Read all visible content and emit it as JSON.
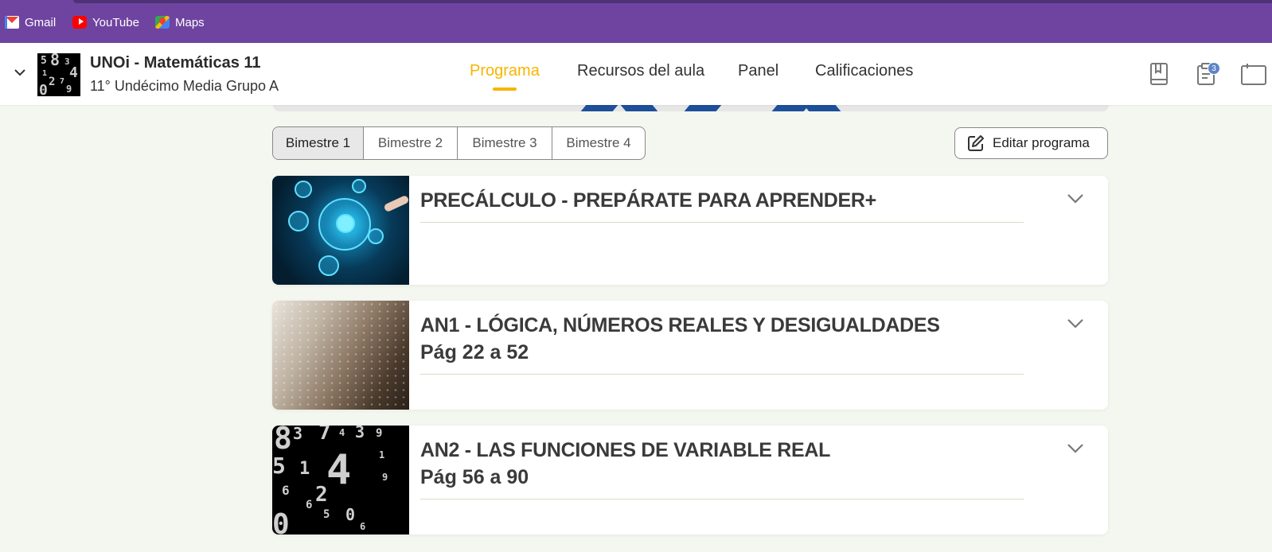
{
  "bookmarks": [
    {
      "label": "Gmail",
      "icon": "gmail-icon"
    },
    {
      "label": "YouTube",
      "icon": "youtube-icon"
    },
    {
      "label": "Maps",
      "icon": "maps-icon"
    }
  ],
  "course": {
    "title": "UNOi - Matemáticas 11",
    "group": "11° Undécimo Media Grupo A"
  },
  "nav": {
    "tabs": [
      "Programa",
      "Recursos del aula",
      "Panel",
      "Calificaciones"
    ],
    "active_tab": "Programa"
  },
  "header_icons": {
    "book": "book-icon",
    "clipboard": "clipboard-icon",
    "clipboard_badge": "3",
    "calendar": "calendar-icon"
  },
  "bimestres": {
    "tabs": [
      "Bimestre 1",
      "Bimestre 2",
      "Bimestre 3",
      "Bimestre 4"
    ],
    "selected": "Bimestre 1"
  },
  "edit_button_label": "Editar programa",
  "units": [
    {
      "title": "PRECÁLCULO - PREPÁRATE PARA APRENDER+",
      "pages": ""
    },
    {
      "title": "AN1 - LÓGICA, NÚMEROS REALES Y DESIGUALDADES",
      "pages": "Pág 22 a 52"
    },
    {
      "title": "AN2 - LAS FUNCIONES DE VARIABLE REAL",
      "pages": "Pág 56 a 90"
    }
  ],
  "colors": {
    "bookmarks_bar": "#6f44a0",
    "accent": "#f7b500",
    "page_bg": "#f4f6f0",
    "badge": "#5d84c8"
  }
}
